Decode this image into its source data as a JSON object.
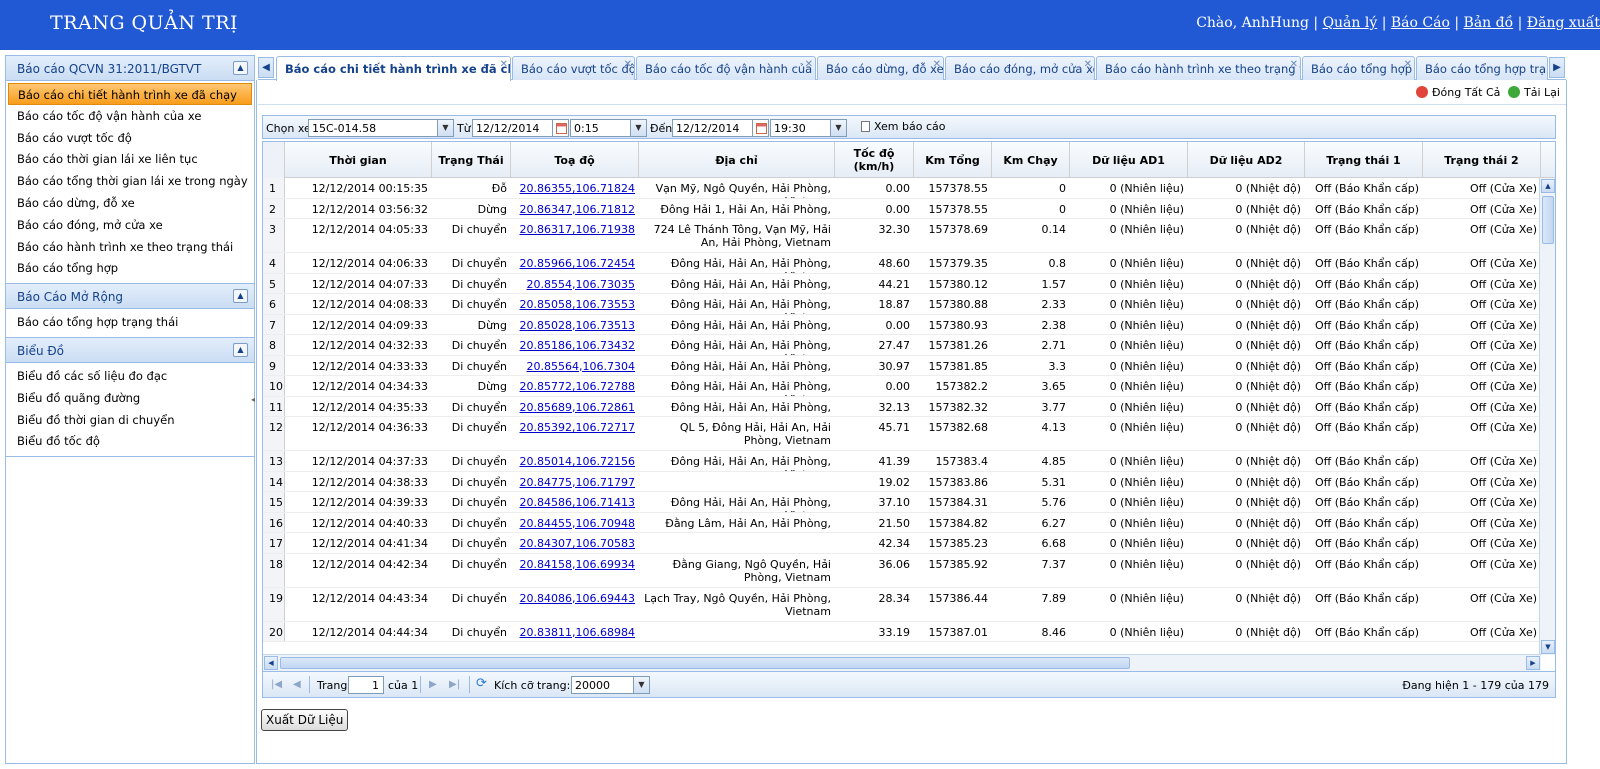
{
  "header": {
    "title": "TRANG QUẢN TRỊ",
    "greeting": "Chào, AnhHung |",
    "links": [
      "Quản lý",
      "Báo Cáo",
      "Bản đồ",
      "Đăng xuất"
    ]
  },
  "sidebar": {
    "panels": [
      {
        "title": "Báo cáo QCVN 31:2011/BGTVT",
        "items": [
          "Báo cáo chi tiết hành trình xe đã chạy",
          "Báo cáo tốc độ vận hành của xe",
          "Báo cáo vượt tốc độ",
          "Báo cáo thời gian lái xe liên tục",
          "Báo cáo tổng thời gian lái xe trong ngày",
          "Báo cáo dừng, đỗ xe",
          "Báo cáo đóng, mở cửa xe",
          "Báo cáo hành trình xe theo trạng thái",
          "Báo cáo tổng hợp"
        ]
      },
      {
        "title": "Báo Cáo Mở Rộng",
        "items": [
          "Báo cáo tổng hợp trạng thái"
        ]
      },
      {
        "title": "Biểu Đồ",
        "items": [
          "Biểu đồ các số liệu đo đạc",
          "Biểu đồ quãng đường",
          "Biểu đồ thời gian di chuyển",
          "Biểu đồ tốc độ"
        ]
      }
    ]
  },
  "tabs": [
    "Báo cáo chi tiết hành trình xe đã chạy",
    "Báo cáo vượt tốc độ",
    "Báo cáo tốc độ vận hành của xe",
    "Báo cáo dừng, đỗ xe",
    "Báo cáo đóng, mở cửa xe",
    "Báo cáo hành trình xe theo trạng thái",
    "Báo cáo tổng hợp",
    "Báo cáo tổng hợp trạng th"
  ],
  "toolbar": {
    "close_all": "Đóng Tất Cả",
    "reload": "Tải Lại"
  },
  "filter": {
    "vehicle_label": "Chọn xe",
    "vehicle_value": "15C-014.58",
    "from_label": "Từ",
    "from_date": "12/12/2014",
    "from_time": "0:15",
    "to_label": "Đến",
    "to_date": "12/12/2014",
    "to_time": "19:30",
    "view_button": "Xem báo cáo"
  },
  "grid": {
    "columns": [
      "",
      "Thời gian",
      "Trạng Thái",
      "Toạ độ",
      "Địa chỉ",
      "Tốc độ (km/h)",
      "Km Tổng",
      "Km Chạy",
      "Dữ liệu AD1",
      "Dữ liệu AD2",
      "Trạng thái 1",
      "Trạng thái 2"
    ],
    "rows": [
      [
        "1",
        "12/12/2014 00:15:35",
        "Đỗ",
        "20.86355,106.71824",
        "Vạn Mỹ, Ngô Quyền, Hải Phòng, Vietnam",
        "0.00",
        "157378.55",
        "0",
        "0 (Nhiên liệu)",
        "0 (Nhiệt độ)",
        "Off (Báo Khẩn cấp)",
        "Off (Cửa Xe)"
      ],
      [
        "2",
        "12/12/2014 03:56:32",
        "Dừng",
        "20.86347,106.71812",
        "Đông Hải 1, Hải An, Hải Phòng, Vietnam",
        "0.00",
        "157378.55",
        "0",
        "0 (Nhiên liệu)",
        "0 (Nhiệt độ)",
        "Off (Báo Khẩn cấp)",
        "Off (Cửa Xe)"
      ],
      [
        "3",
        "12/12/2014 04:05:33",
        "Di chuyển",
        "20.86317,106.71938",
        "724 Lê Thánh Tông, Vạn Mỹ, Hải An, Hải Phòng, Vietnam",
        "32.30",
        "157378.69",
        "0.14",
        "0 (Nhiên liệu)",
        "0 (Nhiệt độ)",
        "Off (Báo Khẩn cấp)",
        "Off (Cửa Xe)"
      ],
      [
        "4",
        "12/12/2014 04:06:33",
        "Di chuyển",
        "20.85966,106.72454",
        "Đông Hải, Hải An, Hải Phòng, Vietnam",
        "48.60",
        "157379.35",
        "0.8",
        "0 (Nhiên liệu)",
        "0 (Nhiệt độ)",
        "Off (Báo Khẩn cấp)",
        "Off (Cửa Xe)"
      ],
      [
        "5",
        "12/12/2014 04:07:33",
        "Di chuyển",
        "20.8554,106.73035",
        "Đông Hải, Hải An, Hải Phòng, Vietnam",
        "44.21",
        "157380.12",
        "1.57",
        "0 (Nhiên liệu)",
        "0 (Nhiệt độ)",
        "Off (Báo Khẩn cấp)",
        "Off (Cửa Xe)"
      ],
      [
        "6",
        "12/12/2014 04:08:33",
        "Di chuyển",
        "20.85058,106.73553",
        "Đông Hải, Hải An, Hải Phòng, Vietnam",
        "18.87",
        "157380.88",
        "2.33",
        "0 (Nhiên liệu)",
        "0 (Nhiệt độ)",
        "Off (Báo Khẩn cấp)",
        "Off (Cửa Xe)"
      ],
      [
        "7",
        "12/12/2014 04:09:33",
        "Dừng",
        "20.85028,106.73513",
        "Đông Hải, Hải An, Hải Phòng, Vietnam",
        "0.00",
        "157380.93",
        "2.38",
        "0 (Nhiên liệu)",
        "0 (Nhiệt độ)",
        "Off (Báo Khẩn cấp)",
        "Off (Cửa Xe)"
      ],
      [
        "8",
        "12/12/2014 04:32:33",
        "Di chuyển",
        "20.85186,106.73432",
        "Đông Hải, Hải An, Hải Phòng, Vietnam",
        "27.47",
        "157381.26",
        "2.71",
        "0 (Nhiên liệu)",
        "0 (Nhiệt độ)",
        "Off (Báo Khẩn cấp)",
        "Off (Cửa Xe)"
      ],
      [
        "9",
        "12/12/2014 04:33:33",
        "Di chuyển",
        "20.85564,106.7304",
        "Đông Hải, Hải An, Hải Phòng, Vietnam",
        "30.97",
        "157381.85",
        "3.3",
        "0 (Nhiên liệu)",
        "0 (Nhiệt độ)",
        "Off (Báo Khẩn cấp)",
        "Off (Cửa Xe)"
      ],
      [
        "10",
        "12/12/2014 04:34:33",
        "Dừng",
        "20.85772,106.72788",
        "Đông Hải, Hải An, Hải Phòng, Vietnam",
        "0.00",
        "157382.2",
        "3.65",
        "0 (Nhiên liệu)",
        "0 (Nhiệt độ)",
        "Off (Báo Khẩn cấp)",
        "Off (Cửa Xe)"
      ],
      [
        "11",
        "12/12/2014 04:35:33",
        "Di chuyển",
        "20.85689,106.72861",
        "Đông Hải, Hải An, Hải Phòng, Vietnam",
        "32.13",
        "157382.32",
        "3.77",
        "0 (Nhiên liệu)",
        "0 (Nhiệt độ)",
        "Off (Báo Khẩn cấp)",
        "Off (Cửa Xe)"
      ],
      [
        "12",
        "12/12/2014 04:36:33",
        "Di chuyển",
        "20.85392,106.72717",
        "QL 5, Đông Hải, Hải An, Hải Phòng, Vietnam",
        "45.71",
        "157382.68",
        "4.13",
        "0 (Nhiên liệu)",
        "0 (Nhiệt độ)",
        "Off (Báo Khẩn cấp)",
        "Off (Cửa Xe)"
      ],
      [
        "13",
        "12/12/2014 04:37:33",
        "Di chuyển",
        "20.85014,106.72156",
        "Đông Hải, Hải An, Hải Phòng, Vietnam",
        "41.39",
        "157383.4",
        "4.85",
        "0 (Nhiên liệu)",
        "0 (Nhiệt độ)",
        "Off (Báo Khẩn cấp)",
        "Off (Cửa Xe)"
      ],
      [
        "14",
        "12/12/2014 04:38:33",
        "Di chuyển",
        "20.84775,106.71797",
        "",
        "19.02",
        "157383.86",
        "5.31",
        "0 (Nhiên liệu)",
        "0 (Nhiệt độ)",
        "Off (Báo Khẩn cấp)",
        "Off (Cửa Xe)"
      ],
      [
        "15",
        "12/12/2014 04:39:33",
        "Di chuyển",
        "20.84586,106.71413",
        "Đông Hải, Hải An, Hải Phòng, Vietnam",
        "37.10",
        "157384.31",
        "5.76",
        "0 (Nhiên liệu)",
        "0 (Nhiệt độ)",
        "Off (Báo Khẩn cấp)",
        "Off (Cửa Xe)"
      ],
      [
        "16",
        "12/12/2014 04:40:33",
        "Di chuyển",
        "20.84455,106.70948",
        "Đằng Lâm, Hải An, Hải Phòng, Vietnam",
        "21.50",
        "157384.82",
        "6.27",
        "0 (Nhiên liệu)",
        "0 (Nhiệt độ)",
        "Off (Báo Khẩn cấp)",
        "Off (Cửa Xe)"
      ],
      [
        "17",
        "12/12/2014 04:41:34",
        "Di chuyển",
        "20.84307,106.70583",
        "",
        "42.34",
        "157385.23",
        "6.68",
        "0 (Nhiên liệu)",
        "0 (Nhiệt độ)",
        "Off (Báo Khẩn cấp)",
        "Off (Cửa Xe)"
      ],
      [
        "18",
        "12/12/2014 04:42:34",
        "Di chuyển",
        "20.84158,106.69934",
        "Đằng Giang, Ngô Quyền, Hải Phòng, Vietnam",
        "36.06",
        "157385.92",
        "7.37",
        "0 (Nhiên liệu)",
        "0 (Nhiệt độ)",
        "Off (Báo Khẩn cấp)",
        "Off (Cửa Xe)"
      ],
      [
        "19",
        "12/12/2014 04:43:34",
        "Di chuyển",
        "20.84086,106.69443",
        "Lạch Tray, Ngô Quyền, Hải Phòng, Vietnam",
        "28.34",
        "157386.44",
        "7.89",
        "0 (Nhiên liệu)",
        "0 (Nhiệt độ)",
        "Off (Báo Khẩn cấp)",
        "Off (Cửa Xe)"
      ],
      [
        "20",
        "12/12/2014 04:44:34",
        "Di chuyển",
        "20.83811,106.68984",
        "",
        "33.19",
        "157387.01",
        "8.46",
        "0 (Nhiên liệu)",
        "0 (Nhiệt độ)",
        "Off (Báo Khẩn cấp)",
        "Off (Cửa Xe)"
      ]
    ]
  },
  "paging": {
    "page_label": "Trang",
    "page_value": "1",
    "of_label": "của 1",
    "size_label": "Kích cỡ trang:",
    "size_value": "20000",
    "summary": "Đang hiện 1 - 179 của 179"
  },
  "export_button": "Xuất Dữ Liệu",
  "colors": {
    "header_bg": "#2159d4",
    "active_item": "#f89c1c",
    "link": "#0000cc",
    "border": "#99bbe8"
  }
}
